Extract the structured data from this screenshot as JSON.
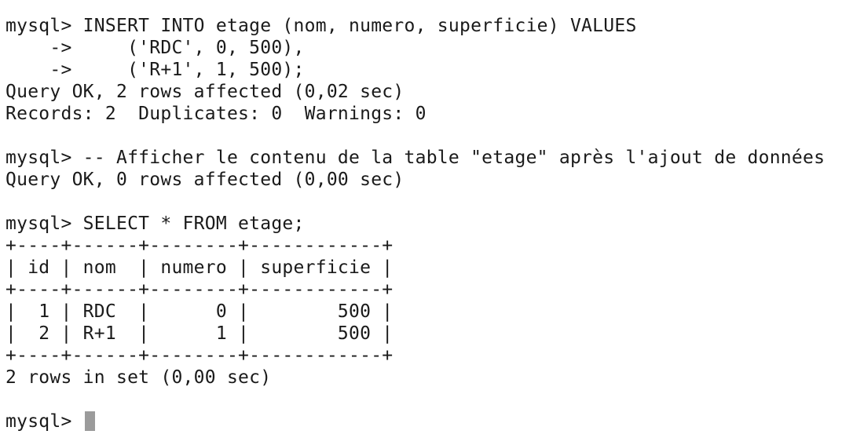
{
  "terminal": {
    "cursor_color": "#9b9b9b",
    "text_color": "#1a1a1a",
    "background": "#ffffff",
    "lines": [
      "mysql> INSERT INTO etage (nom, numero, superficie) VALUES",
      "    ->     ('RDC', 0, 500),",
      "    ->     ('R+1', 1, 500);",
      "Query OK, 2 rows affected (0,02 sec)",
      "Records: 2  Duplicates: 0  Warnings: 0",
      "",
      "mysql> -- Afficher le contenu de la table \"etage\" après l'ajout de données",
      "Query OK, 0 rows affected (0,00 sec)",
      "",
      "mysql> SELECT * FROM etage;",
      "+----+------+--------+------------+",
      "| id | nom  | numero | superficie |",
      "+----+------+--------+------------+",
      "|  1 | RDC  |      0 |        500 |",
      "|  2 | R+1  |      1 |        500 |",
      "+----+------+--------+------------+",
      "2 rows in set (0,00 sec)",
      ""
    ],
    "prompt": "mysql> "
  }
}
